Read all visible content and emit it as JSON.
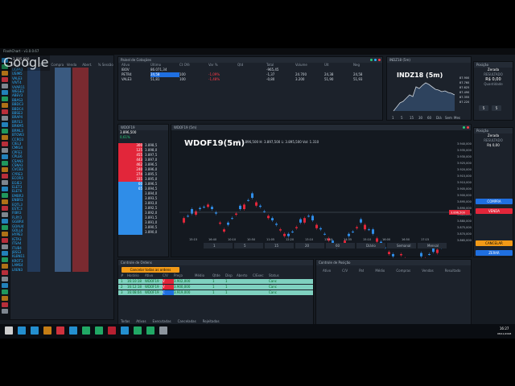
{
  "app": {
    "title": "FlashChart - v1.0.0.67",
    "balance": "3.895.660"
  },
  "left_list": {
    "headers": [
      "Ativo",
      "Últ",
      "Qtde",
      "Compra",
      "Venda",
      "Abert.",
      "% Sessão"
    ],
    "symbols": [
      "UGPA3",
      "USIM5",
      "VALE3",
      "VIVT4",
      "VVAR11",
      "WEGE3",
      "ABEV3",
      "BBAS3",
      "BBDC3",
      "BBDC4",
      "BBSE3",
      "BRAP4",
      "BRFS3",
      "BRKM5",
      "BRML3",
      "BTOW3",
      "CCRO3",
      "CIEL3",
      "CMIG4",
      "CPFE3",
      "CPLE6",
      "CSAN3",
      "CSNA3",
      "CVCB3",
      "CYRE3",
      "ECOR3",
      "EGIE3",
      "ELET3",
      "ELET6",
      "EMBR3",
      "ENBR3",
      "EQTL3",
      "ESTC3",
      "FIBR3",
      "FLRY3",
      "GGBR4",
      "GOAU4",
      "GOLL4",
      "HYPE3",
      "IGTA3",
      "ITSA4",
      "ITUB4",
      "JBSS3",
      "KLBN11",
      "KROT3",
      "LAME4",
      "LREN3"
    ]
  },
  "cotacoes": {
    "title": "Painel de Cotações",
    "headers": [
      "Ativo",
      "Último",
      "Ct Ofé",
      "Var %",
      "Qtd",
      "Total",
      "Volume",
      "Últ",
      "Neg"
    ],
    "rows": [
      {
        "ativo": "IBOV",
        "ultimo": "86.071,34",
        "var": "",
        "qtd": "",
        "neg": "-965,45"
      },
      {
        "ativo": "PETR4",
        "ultimo": "24,58",
        "var": "100",
        "qtd": "-1,09%",
        "neg": "-1,37",
        "v2": "24.700",
        "v3": "24,38",
        "v4": "24,58"
      },
      {
        "ativo": "VALE3",
        "ultimo": "51,81",
        "var": "100",
        "qtd": "-1,48%",
        "neg": "-0,80",
        "v2": "3.200",
        "v3": "51,90",
        "v4": "51,93"
      }
    ]
  },
  "mini_chart": {
    "title": "INDZ18 (5m)",
    "panel": "INDZ18 (5m)",
    "prices": [
      "87.900",
      "87.760",
      "87.625",
      "87.490",
      "87.355",
      "87.220"
    ],
    "times": [
      "10:30",
      "11:00",
      "11:30",
      "12:00"
    ],
    "buttons": [
      "1",
      "5",
      "15",
      "30",
      "60",
      "Diá",
      "Sem",
      "Mes"
    ]
  },
  "order_panel": {
    "title": "Posição",
    "name": "Zerada",
    "labels": [
      "QTD",
      "PREÇO"
    ],
    "resultado_label": "RESULTADO",
    "resultado": "R$ 0,00",
    "qtd_label": "Quantidade",
    "qtd_value": "5",
    "buy": "COMPRA",
    "sell": "VENDA",
    "cancel": "CANCELAR",
    "zerar": "ZERAR"
  },
  "book": {
    "title": "WDOF19",
    "header": [
      "Oferta",
      "Vol",
      "Total"
    ],
    "last": "3.896,500",
    "var": "0,61%",
    "rows": [
      [
        "300",
        "3.898,5"
      ],
      [
        "125",
        "3.898,0"
      ],
      [
        "455",
        "3.897,5"
      ],
      [
        "443",
        "3.897,0"
      ],
      [
        "462",
        "3.896,5"
      ],
      [
        "240",
        "3.896,0"
      ],
      [
        "274",
        "3.895,5"
      ],
      [
        "335",
        "3.895,0"
      ],
      [
        "60",
        "3.896,5"
      ],
      [
        "65",
        "3.894,5"
      ],
      [
        "",
        "3.894,0"
      ],
      [
        "",
        "3.893,5"
      ],
      [
        "",
        "3.893,0"
      ],
      [
        "",
        "3.892,5"
      ],
      [
        "",
        "3.892,0"
      ],
      [
        "",
        "3.891,5"
      ],
      [
        "",
        "3.891,0"
      ],
      [
        "",
        "3.890,5"
      ],
      [
        "",
        "3.890,0"
      ]
    ]
  },
  "main_chart": {
    "panel": "WDOF19 (5m)",
    "title": "WDOF19(5m)",
    "ohlc": "O: 3.896,500  H: 3.897,500  L: 3.895,500  Vol: 1.310",
    "yticks": [
      "3.940,000",
      "3.935,000",
      "3.930,000",
      "3.925,000",
      "3.920,000",
      "3.915,000",
      "3.910,000",
      "3.905,000",
      "3.900,000",
      "3.895,000",
      "3.890,000",
      "3.885,000",
      "3.880,000",
      "3.875,000",
      "3.870,000",
      "3.865,000"
    ],
    "xticks": [
      "15:15",
      "16:40",
      "10:10",
      "10:50",
      "11:05",
      "12:20",
      "13:10",
      "13:50",
      "14:35",
      "15:10",
      "16:00",
      "16:50",
      "17:15"
    ],
    "tf_buttons": [
      "1",
      "5",
      "15",
      "20",
      "60",
      "Diário",
      "Semanal",
      "Mensal"
    ],
    "price_tag": "3.896,500"
  },
  "orders": {
    "title": "Controle de Ordens",
    "cancel_all": "Cancelar todas as ordens",
    "headers": [
      "#",
      "Horário",
      "Ativo",
      "C/V",
      "Preço",
      "Médio",
      "Qtde",
      "Disp",
      "Aberto",
      "C/Exec",
      "Status"
    ],
    "rows": [
      {
        "n": "1",
        "time": "16:10:18",
        "ativo": "WDOF19",
        "cv": "V",
        "preco": "3.902,000",
        "qtde": "1",
        "disp": "1",
        "status": "Canc"
      },
      {
        "n": "2",
        "time": "16:12:18",
        "ativo": "WDOF19",
        "cv": "V",
        "preco": "3.900,000",
        "qtde": "1",
        "disp": "1",
        "status": "Canc"
      },
      {
        "n": "3",
        "time": "16:08:04",
        "ativo": "WDOF19",
        "cv": "C",
        "preco": "3.919,000",
        "qtde": "1",
        "disp": "1",
        "status": "Canc"
      }
    ],
    "tabs": [
      "Todas",
      "Ativas",
      "Executadas",
      "Canceladas",
      "Rejeitadas"
    ]
  },
  "positions": {
    "title": "Controle de Posição",
    "headers": [
      "Ativo",
      "C/V",
      "Pat",
      "Médio",
      "Compras",
      "Vendas",
      "Resultado"
    ]
  },
  "taskbar": {
    "time": "16:27",
    "date": "08/11/2018"
  },
  "watermark": "Google"
}
